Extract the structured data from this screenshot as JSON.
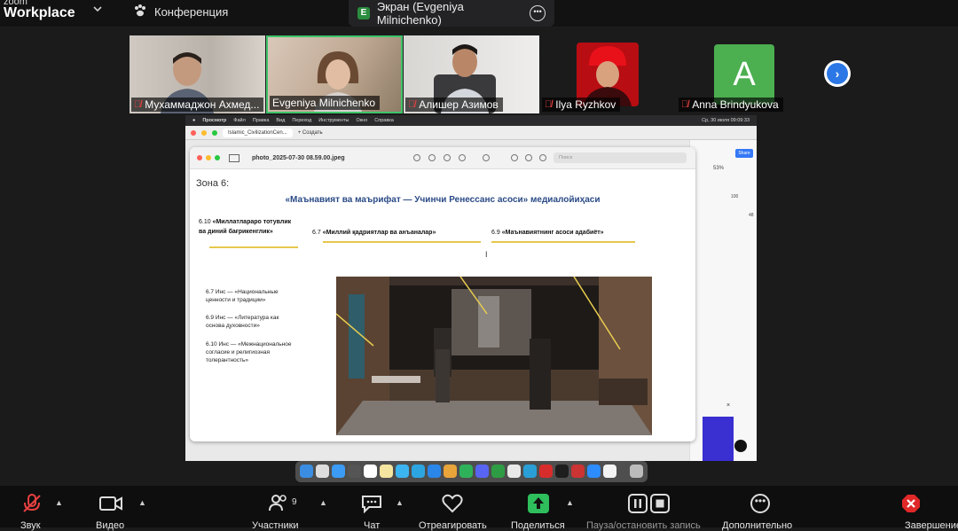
{
  "app": {
    "brand_top": "zoom",
    "brand_name": "Workplace"
  },
  "topbar": {
    "meeting_title": "Конференция",
    "share_tab_badge": "E",
    "share_tab_label": "Экран (Evgeniya Milnichenko)"
  },
  "participants": [
    {
      "name": "Мухаммаджон Ахмед...",
      "muted": true
    },
    {
      "name": "Evgeniya Milnichenko",
      "muted": false,
      "active_speaker": true
    },
    {
      "name": "Алишер Азимов",
      "muted": true
    },
    {
      "name": "Ilya Ryzhkov",
      "muted": true
    },
    {
      "name": "Anna Brindyukova",
      "muted": true,
      "avatar_letter": "A"
    }
  ],
  "shared_screen": {
    "mac_menu": [
      "Просмотр",
      "Файл",
      "Правка",
      "Вид",
      "Переход",
      "Инструменты",
      "Окно",
      "Справка"
    ],
    "mac_clock": "Ср, 30 июля 09:09:33",
    "browser_tab": "Islamic_CivilizationCen...",
    "browser_new_tab": "+ Создать",
    "preview_filename": "photo_2025-07-30 08.59.00.jpeg",
    "preview_search_placeholder": "Поиск",
    "side_panel": {
      "share_label": "Share",
      "zoom_pct": "53%",
      "value_100": "100",
      "value_48": "48"
    },
    "slide": {
      "zone": "Зона 6:",
      "title": "«Маънавият ва маърифат — Учинчи Ренессанс асоси» медиалойиҳаси",
      "label_610_num": "6.10",
      "label_610_line1": "«Миллатлараро тотувлик",
      "label_610_line2": "ва диний бағрикенглик»",
      "label_67_num": "6.7",
      "label_67_text": "«Миллий қадриятлар ва анъаналар»",
      "label_69_num": "6.9",
      "label_69_text": "«Маънавиятнинг асоси адабиёт»",
      "ru_notes": [
        [
          "6.7 Инс — «Национальные",
          "ценности и традиции»"
        ],
        [
          "6.9 Инс — «Литература как",
          "основа духовности»"
        ],
        [
          "6.10 Инс — «Межнациональное",
          "согласие и религиозная",
          "толерантность»"
        ]
      ]
    }
  },
  "toolbar": {
    "audio_label": "Звук",
    "video_label": "Видео",
    "participants_label": "Участники",
    "participants_count": "9",
    "chat_label": "Чат",
    "react_label": "Отреагировать",
    "share_label": "Поделиться",
    "record_label": "Пауза/остановить запись",
    "more_label": "Дополнительно",
    "end_label": "Завершение"
  }
}
